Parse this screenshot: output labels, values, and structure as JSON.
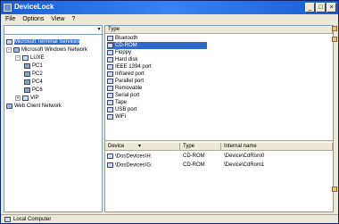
{
  "window": {
    "title": "DeviceLock",
    "buttons": [
      "_",
      "□",
      "×"
    ]
  },
  "menu": {
    "items": [
      "File",
      "Options",
      "View",
      "?"
    ]
  },
  "left": {
    "combo_value": "",
    "tree": [
      {
        "label": "Microsoft Terminal Services",
        "level": 0,
        "expander": "",
        "icon": "terminal-services-icon",
        "selected": true
      },
      {
        "label": "Microsoft Windows Network",
        "level": 0,
        "expander": "-",
        "icon": "network-icon",
        "selected": false
      },
      {
        "label": "LUXE",
        "level": 1,
        "expander": "-",
        "icon": "domain-icon",
        "selected": false
      },
      {
        "label": "PC1",
        "level": 2,
        "expander": "",
        "icon": "computer-icon",
        "selected": false
      },
      {
        "label": "PC2",
        "level": 2,
        "expander": "",
        "icon": "computer-icon",
        "selected": false
      },
      {
        "label": "PC4",
        "level": 2,
        "expander": "",
        "icon": "computer-icon",
        "selected": false
      },
      {
        "label": "PC6",
        "level": 2,
        "expander": "",
        "icon": "computer-icon",
        "selected": false
      },
      {
        "label": "VIP",
        "level": 1,
        "expander": "+",
        "icon": "domain-icon",
        "selected": false
      },
      {
        "label": "Web Client Network",
        "level": 0,
        "expander": "",
        "icon": "network-icon",
        "selected": false
      }
    ]
  },
  "right": {
    "type_header": "Type",
    "types": [
      {
        "label": "Bluetooth",
        "icon": "bluetooth-icon"
      },
      {
        "label": "CD-ROM",
        "icon": "cdrom-icon",
        "selected": true
      },
      {
        "label": "Floppy",
        "icon": "floppy-icon"
      },
      {
        "label": "Hard disk",
        "icon": "hard-disk-icon"
      },
      {
        "label": "IEEE 1394 port",
        "icon": "ieee1394-icon"
      },
      {
        "label": "Infrared port",
        "icon": "infrared-icon"
      },
      {
        "label": "Parallel port",
        "icon": "parallel-port-icon"
      },
      {
        "label": "Removable",
        "icon": "removable-icon"
      },
      {
        "label": "Serial port",
        "icon": "serial-port-icon"
      },
      {
        "label": "Tape",
        "icon": "tape-icon"
      },
      {
        "label": "USB port",
        "icon": "usb-icon"
      },
      {
        "label": "WiFi",
        "icon": "wifi-icon"
      }
    ],
    "device_headers": {
      "device": "Device",
      "type": "Type",
      "internal": "Internal name"
    },
    "devices": [
      {
        "device": "\\DosDevices\\H:",
        "type": "CD-ROM",
        "internal": "\\Device\\CdRom0"
      },
      {
        "device": "\\DosDevices\\G:",
        "type": "CD-ROM",
        "internal": "\\Device\\CdRom1"
      }
    ]
  },
  "status": {
    "text": "Local Computer"
  }
}
